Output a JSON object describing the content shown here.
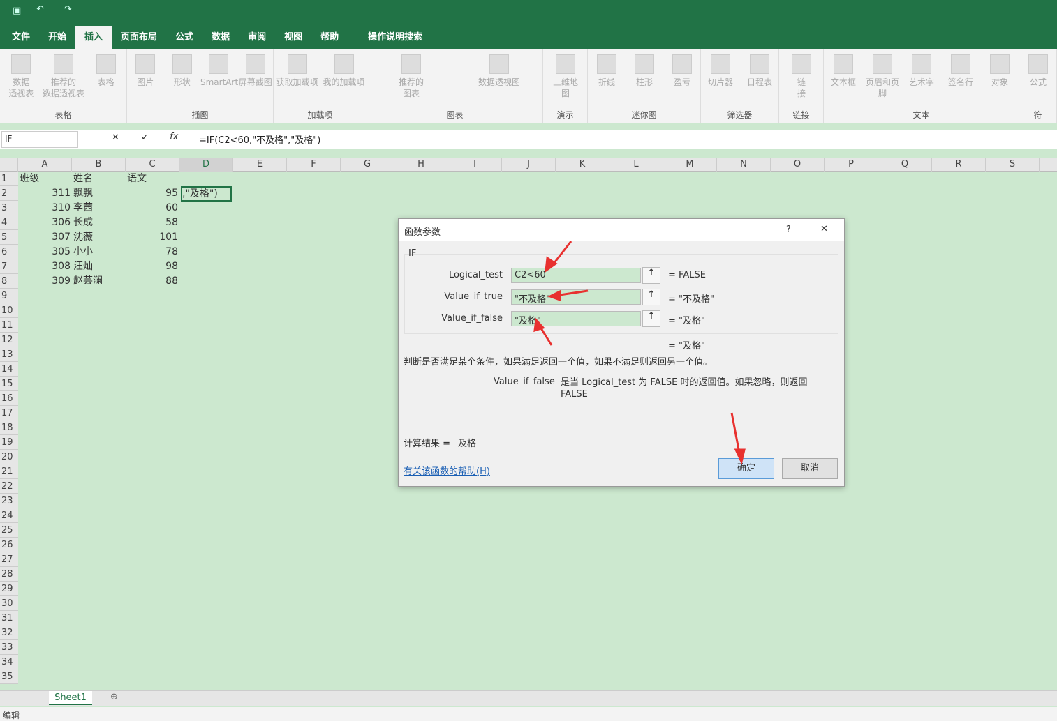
{
  "title_bar": {
    "save": "save-icon",
    "undo": "undo-icon",
    "redo": "redo-icon"
  },
  "tabs": [
    "文件",
    "开始",
    "插入",
    "页面布局",
    "公式",
    "数据",
    "审阅",
    "视图",
    "帮助"
  ],
  "active_tab": "插入",
  "tell_me": "操作说明搜索",
  "ribbon": {
    "groups": [
      {
        "label": "表格",
        "items": [
          "数据\n透视表",
          "推荐的\n数据透视表",
          "表格"
        ]
      },
      {
        "label": "插图",
        "items": [
          "图片",
          "形状",
          "SmartArt",
          "屏幕截图"
        ]
      },
      {
        "label": "加载项",
        "items": [
          "获取加载项",
          "我的加载项"
        ]
      },
      {
        "label": "图表",
        "items": [
          "推荐的\n图表",
          "数据透视图"
        ]
      },
      {
        "label": "演示",
        "items": [
          "三维地\n图"
        ]
      },
      {
        "label": "迷你图",
        "items": [
          "折线",
          "柱形",
          "盈亏"
        ]
      },
      {
        "label": "筛选器",
        "items": [
          "切片器",
          "日程表"
        ]
      },
      {
        "label": "链接",
        "items": [
          "链\n接"
        ]
      },
      {
        "label": "文本",
        "items": [
          "文本框",
          "页眉和页脚",
          "艺术字",
          "签名行",
          "对象"
        ]
      },
      {
        "label": "符",
        "items": [
          "公式"
        ]
      }
    ]
  },
  "formula_bar": {
    "name_box": "IF",
    "formula": "=IF(C2<60,\"不及格\",\"及格\")",
    "fx": "fx"
  },
  "columns": [
    "A",
    "B",
    "C",
    "D",
    "E",
    "F",
    "G",
    "H",
    "I",
    "J",
    "K",
    "L",
    "M",
    "N",
    "O",
    "P",
    "Q",
    "R",
    "S"
  ],
  "rows": [
    [
      "班级",
      "姓名",
      "语文",
      ""
    ],
    [
      "311",
      "飘飘",
      "95",
      ",\"及格\")"
    ],
    [
      "310",
      "李茜",
      "60",
      ""
    ],
    [
      "306",
      "长成",
      "58",
      ""
    ],
    [
      "307",
      "沈薇",
      "101",
      ""
    ],
    [
      "305",
      "小小",
      "78",
      ""
    ],
    [
      "308",
      "汪灿",
      "98",
      ""
    ],
    [
      "309",
      "赵芸澜",
      "88",
      ""
    ]
  ],
  "row_count": 35,
  "dialog": {
    "title": "函数参数",
    "help": "?",
    "close": "✕",
    "function": "IF",
    "args": [
      {
        "label": "Logical_test",
        "value": "C2<60",
        "result": "FALSE"
      },
      {
        "label": "Value_if_true",
        "value": "\"不及格\"",
        "result": "\"不及格\""
      },
      {
        "label": "Value_if_false",
        "value": "\"及格\"",
        "result": "\"及格\""
      }
    ],
    "overall_result": "\"及格\"",
    "description": "判断是否满足某个条件，如果满足返回一个值，如果不满足则返回另一个值。",
    "arg_name": "Value_if_false",
    "arg_desc": "是当 Logical_test 为 FALSE 时的返回值。如果忽略，则返回 FALSE",
    "calc_label": "计算结果 =",
    "calc_value": "及格",
    "help_link": "有关该函数的帮助(H)",
    "ok": "确定",
    "cancel": "取消"
  },
  "sheet_tab": "Sheet1",
  "status": "编辑",
  "colors": {
    "excel_green": "#217346",
    "sheet_bg": "#cce8cf",
    "arrow": "#e8312f"
  }
}
